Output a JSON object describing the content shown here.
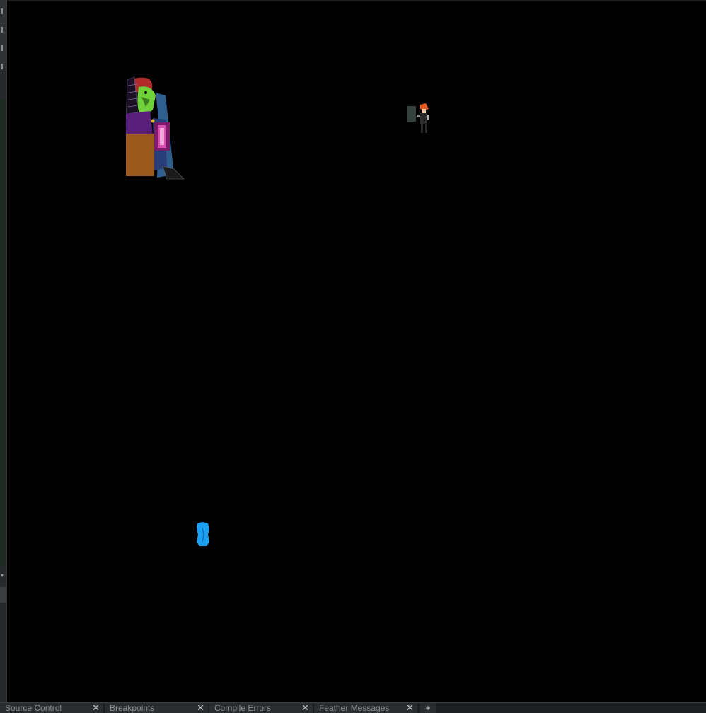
{
  "output_tabs": [
    {
      "label": "Source Control",
      "close_icon": "close-icon"
    },
    {
      "label": "Breakpoints",
      "close_icon": "close-icon"
    },
    {
      "label": "Compile Errors",
      "close_icon": "close-icon"
    },
    {
      "label": "Feather Messages",
      "close_icon": "close-icon"
    }
  ],
  "add_tab_label": "+",
  "icons": {
    "close": "✕"
  },
  "colors": {
    "room_background": "#000000",
    "blue_sprite": "#1ba0f2",
    "character_hair": "#c0392b",
    "character_skin": "#6fd23a",
    "character_coat": "#2e5f8f",
    "character_vest": "#5a1f7a",
    "character_pants": "#9a5a1e"
  }
}
